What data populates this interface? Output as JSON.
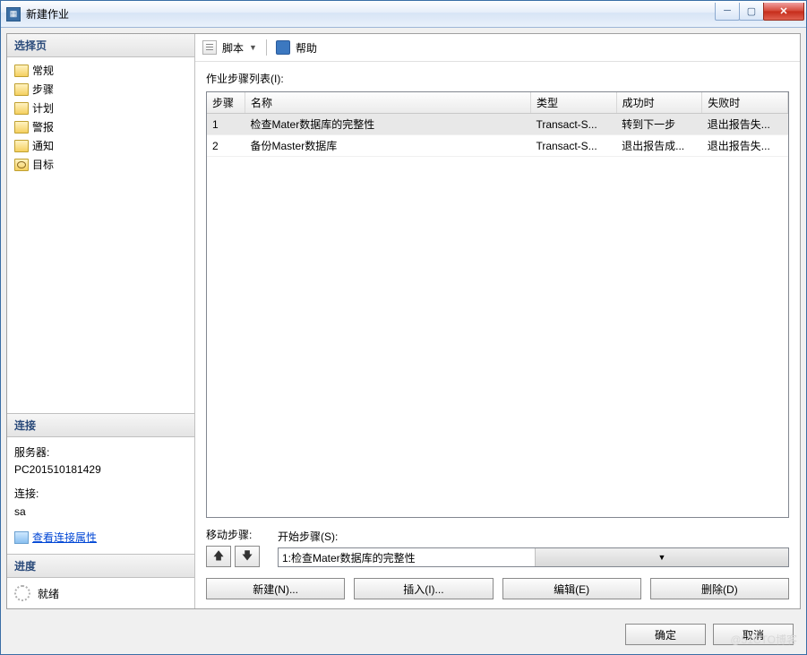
{
  "window": {
    "title": "新建作业"
  },
  "sidebar": {
    "select_header": "选择页",
    "items": [
      {
        "label": "常规"
      },
      {
        "label": "步骤"
      },
      {
        "label": "计划"
      },
      {
        "label": "警报"
      },
      {
        "label": "通知"
      },
      {
        "label": "目标"
      }
    ],
    "connection_header": "连接",
    "server_label": "服务器:",
    "server_value": "PC201510181429",
    "conn_label": "连接:",
    "conn_value": "sa",
    "view_props": "查看连接属性",
    "progress_header": "进度",
    "progress_status": "就绪"
  },
  "toolbar": {
    "script": "脚本",
    "help": "帮助"
  },
  "main": {
    "list_label": "作业步骤列表(I):",
    "columns": {
      "step": "步骤",
      "name": "名称",
      "type": "类型",
      "ok": "成功时",
      "fail": "失败时"
    },
    "rows": [
      {
        "step": "1",
        "name": "检查Mater数据库的完整性",
        "type": "Transact-S...",
        "ok": "转到下一步",
        "fail": "退出报告失..."
      },
      {
        "step": "2",
        "name": "备份Master数据库",
        "type": "Transact-S...",
        "ok": "退出报告成...",
        "fail": "退出报告失..."
      }
    ],
    "move_label": "移动步骤:",
    "start_label": "开始步骤(S):",
    "start_value": "1:检查Mater数据库的完整性",
    "buttons": {
      "new": "新建(N)...",
      "insert": "插入(I)...",
      "edit": "编辑(E)",
      "delete": "删除(D)"
    }
  },
  "footer": {
    "ok": "确定",
    "cancel": "取消"
  },
  "watermark": "@51CTO博客"
}
